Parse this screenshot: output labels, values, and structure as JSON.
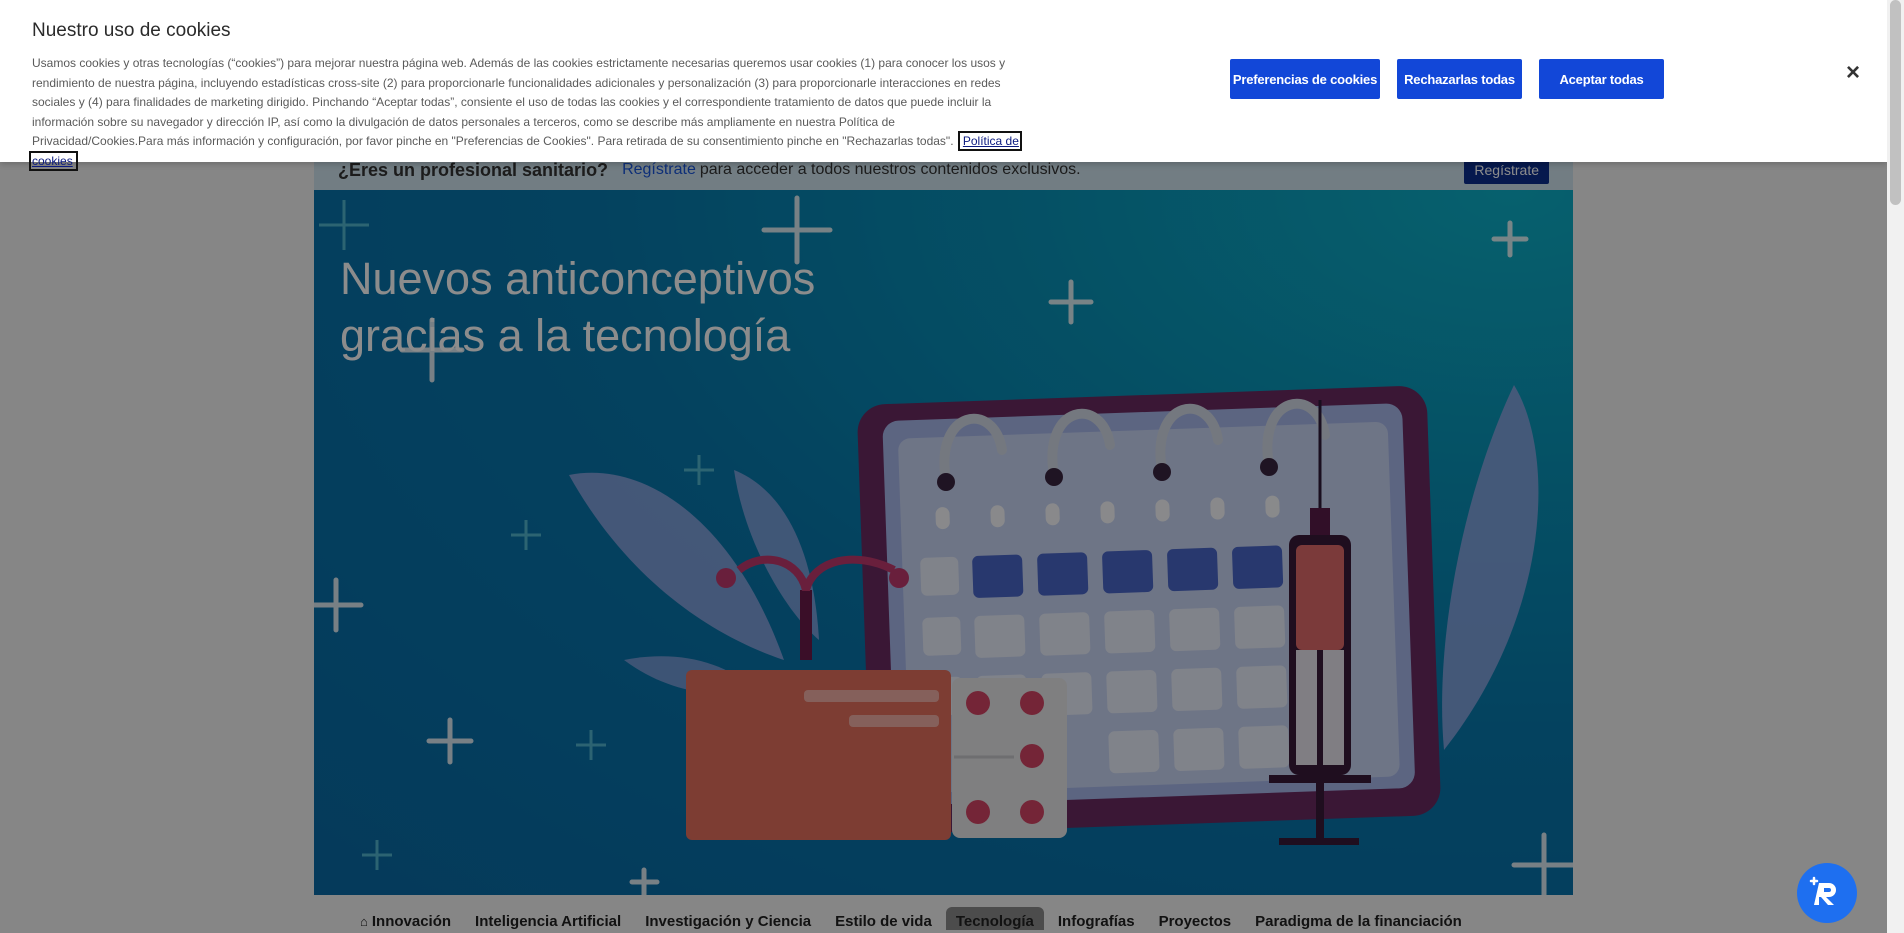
{
  "cookie_banner": {
    "title": "Nuestro uso de cookies",
    "text": "Usamos cookies y otras tecnologías (“cookies”) para mejorar nuestra página web. Además de las cookies estrictamente necesarias queremos usar cookies (1) para conocer los usos y rendimiento de nuestra página, incluyendo estadísticas cross-site (2) para proporcionarle funcionalidades adicionales y personalización (3) para proporcionarle interacciones en redes sociales y (4) para finalidades de marketing dirigido. Pinchando “Aceptar todas”, consiente el uso de todas las cookies y el correspondiente tratamiento de datos que puede incluir la información sobre su navegador y dirección IP, así como la divulgación de datos personales a terceros, como se describe más ampliamente en nuestra Política de Privacidad/Cookies.Para más información y configuración, por favor pinche en \"Preferencias de Cookies\". Para retirada de su consentimiento pinche en \"Rechazarlas todas\".",
    "policy_link": "Política de cookies",
    "buttons": {
      "preferences": "Preferencias de cookies",
      "reject_all": "Rechazarlas todas",
      "accept_all": "Aceptar todas"
    },
    "close_icon": "close-icon",
    "close_glyph": "×"
  },
  "pro_bar": {
    "question": "¿Eres un profesional sanitario?",
    "link": "Regístrate",
    "text": "para acceder a todos nuestros contenidos exclusivos.",
    "button": "Regístrate"
  },
  "hero": {
    "title": "Nuevos anticonceptivos gracias a la tecnología"
  },
  "nav": {
    "items": [
      {
        "label": "Innovación",
        "icon": "home-icon"
      },
      {
        "label": "Inteligencia Artificial"
      },
      {
        "label": "Investigación y Ciencia"
      },
      {
        "label": "Estilo de vida"
      },
      {
        "label": "Tecnología",
        "active": true
      },
      {
        "label": "Infografías"
      },
      {
        "label": "Proyectos"
      },
      {
        "label": "Paradigma de la financiación"
      }
    ]
  },
  "colors": {
    "primary_button": "#1247d8",
    "hero_bg": "#0a7fb0",
    "overlay": "rgba(0,0,0,0.45)"
  },
  "chat_icon": "chat-assistant-icon"
}
